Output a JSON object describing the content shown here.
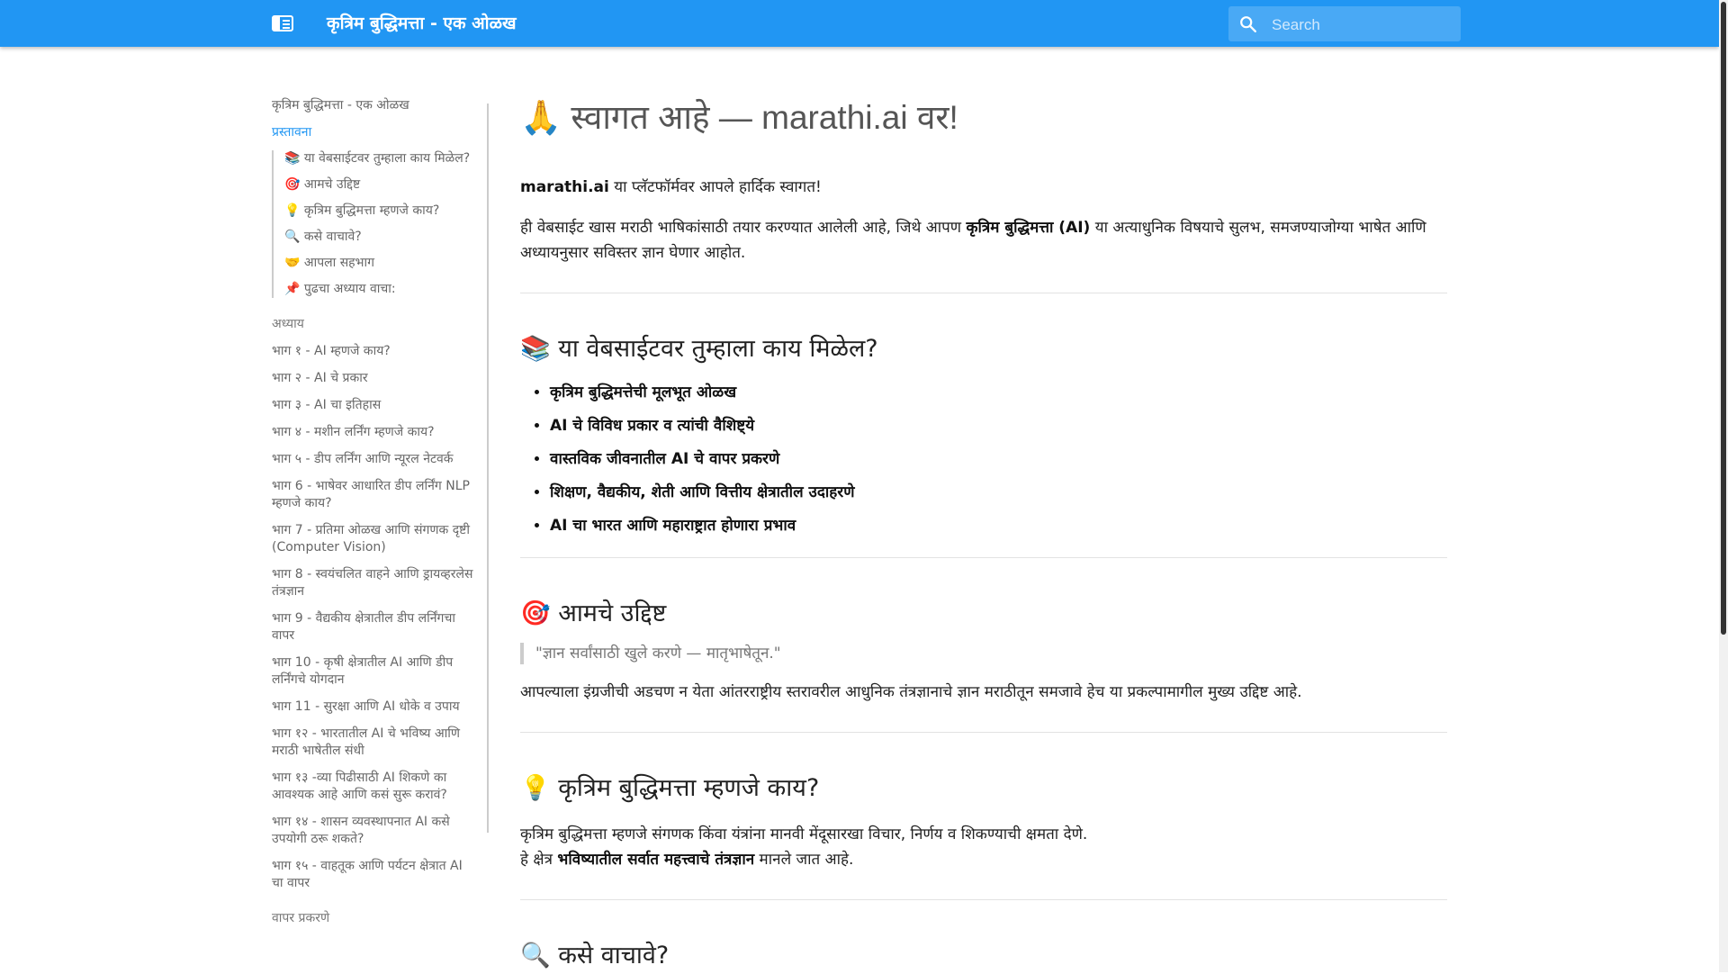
{
  "header": {
    "menu_icon": "sidebar-toggle-icon",
    "title": "कृत्रिम बुद्धिमत्ता - एक ओळख",
    "search_icon": "search-icon",
    "search_placeholder": "Search",
    "search_value": ""
  },
  "sidebar": {
    "home": "कृत्रिम बुद्धिमत्ता - एक ओळख",
    "active_page": "प्रस्तावना",
    "toc": [
      "📚 या वेबसाईटवर तुम्हाला काय मिळेल?",
      "🎯 आमचे उद्दिष्ट",
      "💡 कृत्रिम बुद्धिमत्ता म्हणजे काय?",
      "🔍 कसे वाचावे?",
      "🤝 आपला सहभाग",
      "📌 पुढचा अध्याय वाचा:"
    ],
    "chapters_heading": "अध्याय",
    "chapters": [
      "भाग १ - AI म्हणजे काय?",
      "भाग २ - AI चे प्रकार",
      "भाग ३ - AI चा इतिहास",
      "भाग ४ - मशीन लर्निंग म्हणजे काय?",
      "भाग ५ - डीप लर्निंग आणि न्यूरल नेटवर्क",
      "भाग 6 - भाषेवर आधारित डीप लर्निंग NLP म्हणजे काय?",
      "भाग 7 - प्रतिमा ओळख आणि संगणक दृष्टी (Computer Vision)",
      "भाग 8 - स्वयंचलित वाहने आणि ड्रायव्हरलेस तंत्रज्ञान",
      "भाग 9 - वैद्यकीय क्षेत्रातील डीप लर्निंगचा वापर",
      "भाग 10 - कृषी क्षेत्रातील AI आणि डीप लर्निंगचे योगदान",
      "भाग 11 - सुरक्षा आणि AI धोके व उपाय",
      "भाग १२ - भारतातील AI चे भविष्य आणि मराठी भाषेतील संधी",
      "भाग १३ -व्या पिढीसाठी AI शिकणे का आवश्यक आहे आणि कसं सुरू करावं?",
      "भाग १४ - शासन व्यवस्थापनात AI कसे उपयोगी ठरू शकते?",
      "भाग १५ - वाहतूक आणि पर्यटन क्षेत्रात AI चा वापर"
    ],
    "next_heading_partial": "वापर प्रकरणे"
  },
  "main": {
    "title": "🙏 स्वागत आहे — marathi.ai वर!",
    "welcome_bold": "marathi.ai",
    "welcome_rest": " या प्लॅटफॉर्मवर आपले हार्दिक स्वागत!",
    "intro_before": "ही वेबसाईट खास मराठी भाषिकांसाठी तयार करण्यात आलेली आहे, जिथे आपण ",
    "intro_bold": "कृत्रिम बुद्धिमत्ता (AI)",
    "intro_after": " या अत्याधुनिक विषयाचे सुलभ, समजण्याजोग्या भाषेत आणि अध्यायनुसार सविस्तर ज्ञान घेणार आहोत.",
    "section1_title": "📚 या वेबसाईटवर तुम्हाला काय मिळेल?",
    "features": [
      "कृत्रिम बुद्धिमत्तेची मूलभूत ओळख",
      "AI चे विविध प्रकार व त्यांची वैशिष्ट्ये",
      "वास्तविक जीवनातील AI चे वापर प्रकरणे",
      "शिक्षण, वैद्यकीय, शेती आणि वित्तीय क्षेत्रातील उदाहरणे",
      "AI चा भारत आणि महाराष्ट्रात होणारा प्रभाव"
    ],
    "section2_title": "🎯 आमचे उद्दिष्ट",
    "quote": "\"ज्ञान सर्वांसाठी खुले करणे — मातृभाषेतून.\"",
    "goal_text": "आपल्याला इंग्रजीची अडचण न येता आंतरराष्ट्रीय स्तरावरील आधुनिक तंत्रज्ञानाचे ज्ञान मराठीतून समजावे हेच या प्रकल्पामागील मुख्य उद्दिष्ट आहे.",
    "section3_title": "💡 कृत्रिम बुद्धिमत्ता म्हणजे काय?",
    "def_line1": "कृत्रिम बुद्धिमत्ता म्हणजे संगणक किंवा यंत्रांना मानवी मेंदूसारखा विचार, निर्णय व शिकण्याची क्षमता देणे.",
    "def_line2_before": "हे क्षेत्र ",
    "def_line2_bold": "भविष्यातील सर्वात महत्त्वाचे तंत्रज्ञान",
    "def_line2_after": " मानले जात आहे.",
    "section4_title_partial": "🔍 कसे वाचावे?"
  },
  "colors": {
    "header_bg": "#2196f3",
    "link_active": "#2196f3",
    "text": "#222222",
    "muted": "#666666"
  }
}
